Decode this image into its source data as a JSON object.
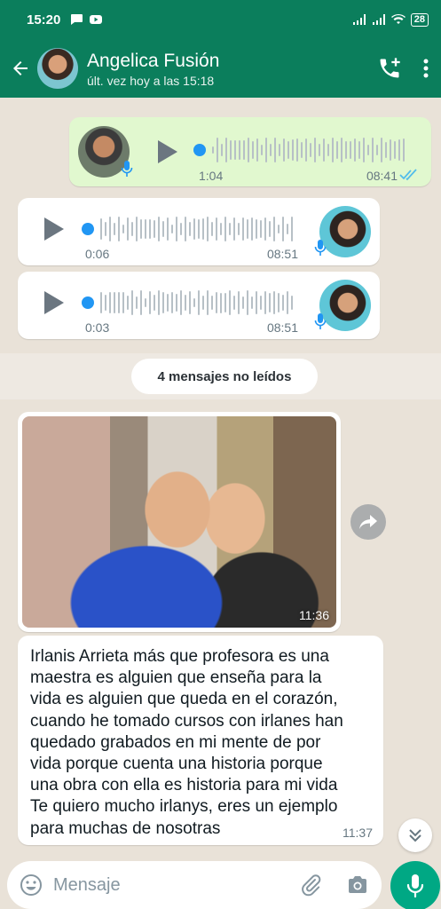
{
  "status_bar": {
    "time": "15:20",
    "battery": "28"
  },
  "header": {
    "contact_name": "Angelica Fusión",
    "contact_status": "últ. vez hoy a las 15:18"
  },
  "messages": {
    "voice_out": {
      "duration": "1:04",
      "time": "08:41"
    },
    "voice_in_1": {
      "duration": "0:06",
      "time": "08:51"
    },
    "voice_in_2": {
      "duration": "0:03",
      "time": "08:51"
    },
    "unread_label": "4 mensajes no leídos",
    "photo": {
      "time": "11:36"
    },
    "text": {
      "body": "Irlanis Arrieta más que profesora es una\nmaestra es alguien que enseña para la\nvida es alguien que queda en el corazón,\ncuando he tomado cursos con irlanes han\nquedado grabados en mi mente de por\nvida porque cuenta una historia porque\nuna obra con ella es historia para mi vida\nTe quiero mucho irlanys, eres un ejemplo\npara muchas de nosotras",
      "time": "11:37"
    }
  },
  "composer": {
    "placeholder": "Mensaje"
  },
  "colors": {
    "header": "#0b7e5c",
    "accent": "#00a884",
    "outgoing": "#e1f8cf"
  }
}
